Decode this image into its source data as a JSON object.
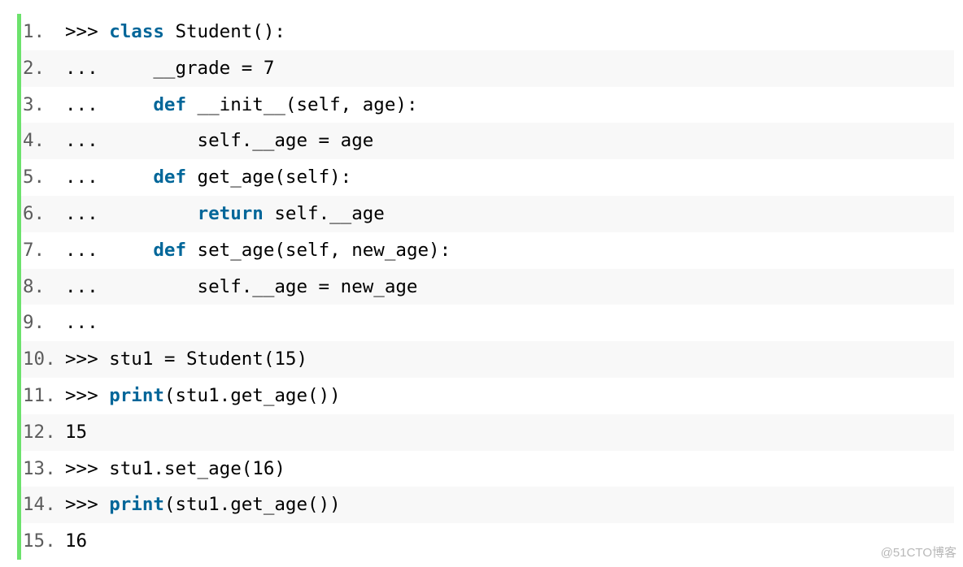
{
  "colors": {
    "accent_border": "#6ce26c",
    "keyword": "#006699",
    "row_alt": "#f8f8f8"
  },
  "lines": [
    {
      "num": "1.",
      "parts": [
        {
          "t": ">>> "
        },
        {
          "t": "class",
          "kw": true
        },
        {
          "t": " Student():"
        }
      ]
    },
    {
      "num": "2.",
      "parts": [
        {
          "t": "...     __grade = 7"
        }
      ]
    },
    {
      "num": "3.",
      "parts": [
        {
          "t": "...     "
        },
        {
          "t": "def",
          "kw": true
        },
        {
          "t": " __init__(self, age):"
        }
      ]
    },
    {
      "num": "4.",
      "parts": [
        {
          "t": "...         self.__age = age"
        }
      ]
    },
    {
      "num": "5.",
      "parts": [
        {
          "t": "...     "
        },
        {
          "t": "def",
          "kw": true
        },
        {
          "t": " get_age(self):"
        }
      ]
    },
    {
      "num": "6.",
      "parts": [
        {
          "t": "...         "
        },
        {
          "t": "return",
          "kw": true
        },
        {
          "t": " self.__age"
        }
      ]
    },
    {
      "num": "7.",
      "parts": [
        {
          "t": "...     "
        },
        {
          "t": "def",
          "kw": true
        },
        {
          "t": " set_age(self, new_age):"
        }
      ]
    },
    {
      "num": "8.",
      "parts": [
        {
          "t": "...         self.__age = new_age"
        }
      ]
    },
    {
      "num": "9.",
      "parts": [
        {
          "t": "..."
        }
      ]
    },
    {
      "num": "10.",
      "parts": [
        {
          "t": ">>> stu1 = Student(15)"
        }
      ]
    },
    {
      "num": "11.",
      "parts": [
        {
          "t": ">>> "
        },
        {
          "t": "print",
          "kw": true
        },
        {
          "t": "(stu1.get_age())"
        }
      ]
    },
    {
      "num": "12.",
      "parts": [
        {
          "t": "15"
        }
      ]
    },
    {
      "num": "13.",
      "parts": [
        {
          "t": ">>> stu1.set_age(16)"
        }
      ]
    },
    {
      "num": "14.",
      "parts": [
        {
          "t": ">>> "
        },
        {
          "t": "print",
          "kw": true
        },
        {
          "t": "(stu1.get_age())"
        }
      ]
    },
    {
      "num": "15.",
      "parts": [
        {
          "t": "16"
        }
      ]
    }
  ],
  "watermark": "@51CTO博客"
}
